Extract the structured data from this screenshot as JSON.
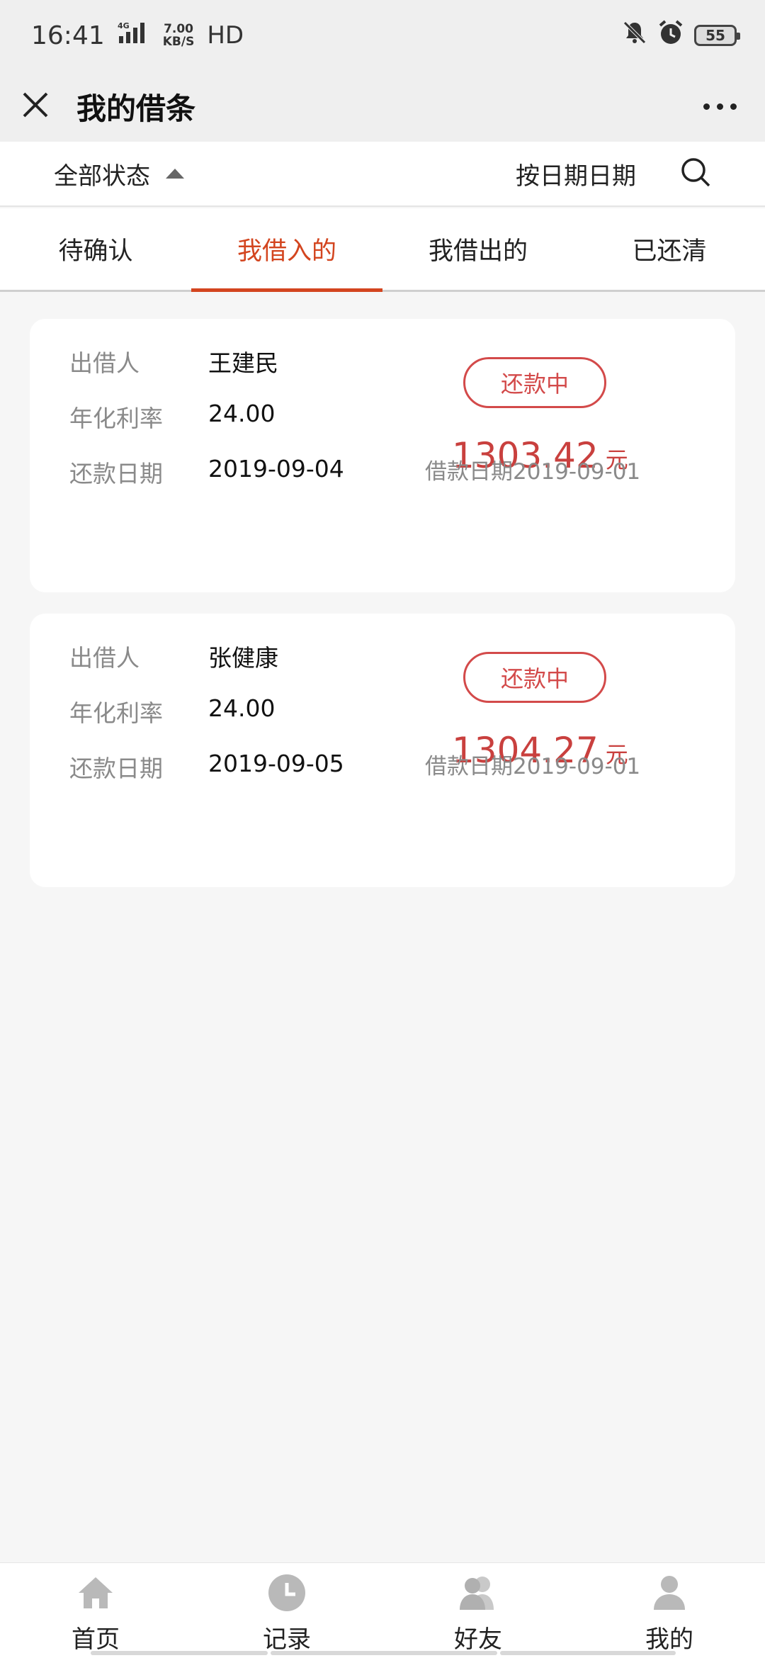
{
  "status_bar": {
    "time": "16:41",
    "network": "4G",
    "speed_value": "7.00",
    "speed_unit": "KB/S",
    "hd": "HD",
    "battery": "55"
  },
  "header": {
    "title": "我的借条"
  },
  "filter": {
    "status_label": "全部状态",
    "date_label": "按日期日期"
  },
  "tabs": [
    {
      "label": "待确认"
    },
    {
      "label": "我借入的"
    },
    {
      "label": "我借出的"
    },
    {
      "label": "已还清"
    }
  ],
  "loans": [
    {
      "lender_label": "出借人",
      "lender": "王建民",
      "rate_label": "年化利率",
      "rate": "24.00",
      "due_label": "还款日期",
      "due_date": "2019-09-04",
      "status": "还款中",
      "amount": "1303.42",
      "unit": "元",
      "loan_date": "借款日期2019-09-01"
    },
    {
      "lender_label": "出借人",
      "lender": "张健康",
      "rate_label": "年化利率",
      "rate": "24.00",
      "due_label": "还款日期",
      "due_date": "2019-09-05",
      "status": "还款中",
      "amount": "1304.27",
      "unit": "元",
      "loan_date": "借款日期2019-09-01"
    }
  ],
  "bottom_nav": [
    {
      "label": "首页",
      "icon": "home-icon"
    },
    {
      "label": "记录",
      "icon": "clock-icon"
    },
    {
      "label": "好友",
      "icon": "friends-icon"
    },
    {
      "label": "我的",
      "icon": "person-icon"
    }
  ],
  "colors": {
    "accent": "#d3451f",
    "status_red": "#d34a4a",
    "amount_red": "#c9403e"
  }
}
